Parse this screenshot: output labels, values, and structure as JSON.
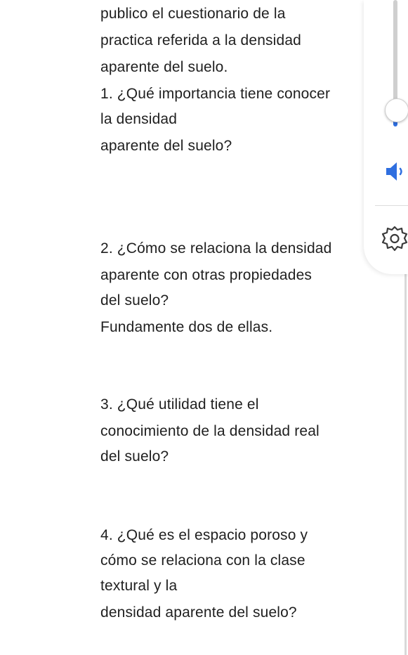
{
  "document": {
    "lines": [
      "publico el cuestionario de la",
      "practica referida a la densidad",
      "aparente del suelo.",
      "1. ¿Qué importancia tiene conocer",
      "la densidad",
      "aparente del suelo?",
      "2. ¿Cómo se relaciona la densidad",
      "aparente con otras propiedades",
      "del suelo?",
      "Fundamente dos de ellas.",
      "3. ¿Qué utilidad tiene el",
      "conocimiento de la densidad real",
      "del suelo?",
      "4. ¿Qué es el espacio poroso y",
      "cómo se relaciona con la clase",
      "textural y la",
      "densidad aparente del suelo?"
    ]
  },
  "volume_panel": {
    "speaker_icon": "speaker-icon",
    "settings_icon": "gear-icon",
    "accent_color": "#2f6fe0"
  }
}
